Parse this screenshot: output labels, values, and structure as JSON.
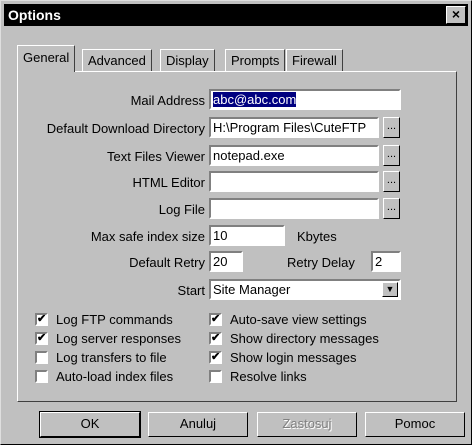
{
  "window": {
    "title": "Options",
    "close_glyph": "×"
  },
  "tabs": [
    "General",
    "Advanced",
    "Display",
    "Prompts",
    "Firewall"
  ],
  "fields": {
    "mail_address": {
      "label": "Mail Address",
      "value": "abc@abc.com"
    },
    "download_dir": {
      "label": "Default Download Directory",
      "value": "H:\\Program Files\\CuteFTP"
    },
    "text_viewer": {
      "label": "Text Files Viewer",
      "value": "notepad.exe"
    },
    "html_editor": {
      "label": "HTML Editor",
      "value": ""
    },
    "log_file": {
      "label": "Log File",
      "value": ""
    },
    "max_index": {
      "label": "Max safe index size",
      "value": "10",
      "unit": "Kbytes"
    },
    "default_retry": {
      "label": "Default Retry",
      "value": "20"
    },
    "retry_delay": {
      "label": "Retry Delay",
      "value": "2"
    },
    "start": {
      "label": "Start",
      "value": "Site Manager"
    }
  },
  "browse_label": "...",
  "checkboxes_left": [
    {
      "label": "Log FTP commands",
      "checked": true
    },
    {
      "label": "Log server responses",
      "checked": true
    },
    {
      "label": "Log transfers to file",
      "checked": false
    },
    {
      "label": "Auto-load index files",
      "checked": false
    }
  ],
  "checkboxes_right": [
    {
      "label": "Auto-save view settings",
      "checked": true
    },
    {
      "label": "Show directory messages",
      "checked": true
    },
    {
      "label": "Show login messages",
      "checked": true
    },
    {
      "label": "Resolve links",
      "checked": false
    }
  ],
  "buttons": {
    "ok": "OK",
    "cancel": "Anuluj",
    "apply": "Zastosuj",
    "help": "Pomoc"
  },
  "check_glyph": "✔"
}
